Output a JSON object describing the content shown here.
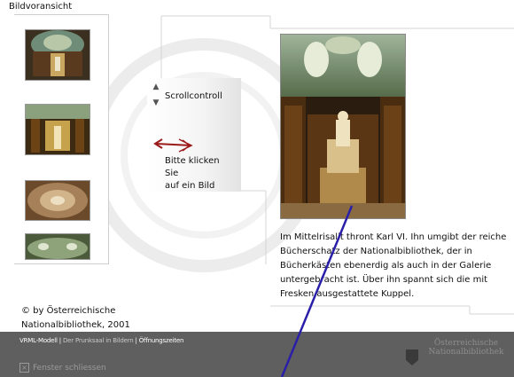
{
  "page": {
    "title": "Bildvoransicht"
  },
  "thumbnails": [
    {
      "alt": "Prunksaal Kuppel"
    },
    {
      "alt": "Prunksaal Galerie"
    },
    {
      "alt": "Prunksaal Mittelrisalit"
    },
    {
      "alt": "Prunksaal Seitenansicht"
    }
  ],
  "scroll": {
    "label": "Scrollcontroll",
    "up_icon": "arrow-up-icon",
    "down_icon": "arrow-down-icon"
  },
  "hint": {
    "icon": "red-arrow-icon",
    "line1": "Bitte klicken",
    "line2": "Sie",
    "line3": "auf ein Bild"
  },
  "main_image": {
    "alt": "Mittelrisalit mit Statue Karl VI."
  },
  "description": {
    "text": "Im Mittelrisalit thront Karl VI. Ihn umgibt der reiche Bücherschatz der Nationalbibliothek, der in Bücherkästen ebenerdig als auch in der Galerie untergebracht ist. Über ihn spannt sich die mit Fresken ausgestattete Kuppel."
  },
  "copyright": {
    "line1": "© by Österreichische",
    "line2": "Nationalbibliothek, 2001"
  },
  "footer": {
    "nav": {
      "item1": "VRML-Modell",
      "sep1": " | ",
      "item2": "Der Prunksaal in Bildern",
      "sep2": " | ",
      "item3": "Öffnungszeiten"
    },
    "close_label": "Fenster schliessen",
    "logo_line1": "Österreichische",
    "logo_line2": "Nationalbibliothek"
  },
  "colors": {
    "footer_bg": "#5f5f5f",
    "annotation_line": "#2a1fa8",
    "hint_arrow": "#9b1b1b"
  }
}
